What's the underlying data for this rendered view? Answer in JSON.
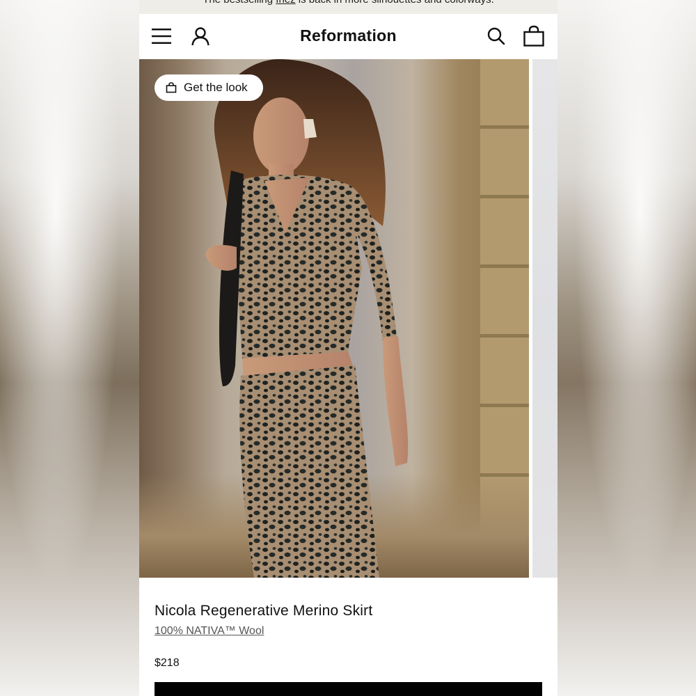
{
  "promo": {
    "text_before": "The bestselling ",
    "link_text": "Inez",
    "text_after": " is back in more silhouettes and colorways."
  },
  "header": {
    "brand": "Reformation",
    "menu_icon": "hamburger-menu-icon",
    "account_icon": "user-account-icon",
    "search_icon": "search-icon",
    "bag_icon": "shopping-bag-icon"
  },
  "gallery": {
    "get_the_look_label": "Get the look",
    "chip_icon": "shopping-bag-icon"
  },
  "product": {
    "name": "Nicola Regenerative Merino Skirt",
    "material": "100% NATIVA™ Wool",
    "price": "$218"
  },
  "colors": {
    "promo_bg": "#efede7",
    "text": "#111111",
    "cta_bg": "#000000"
  }
}
